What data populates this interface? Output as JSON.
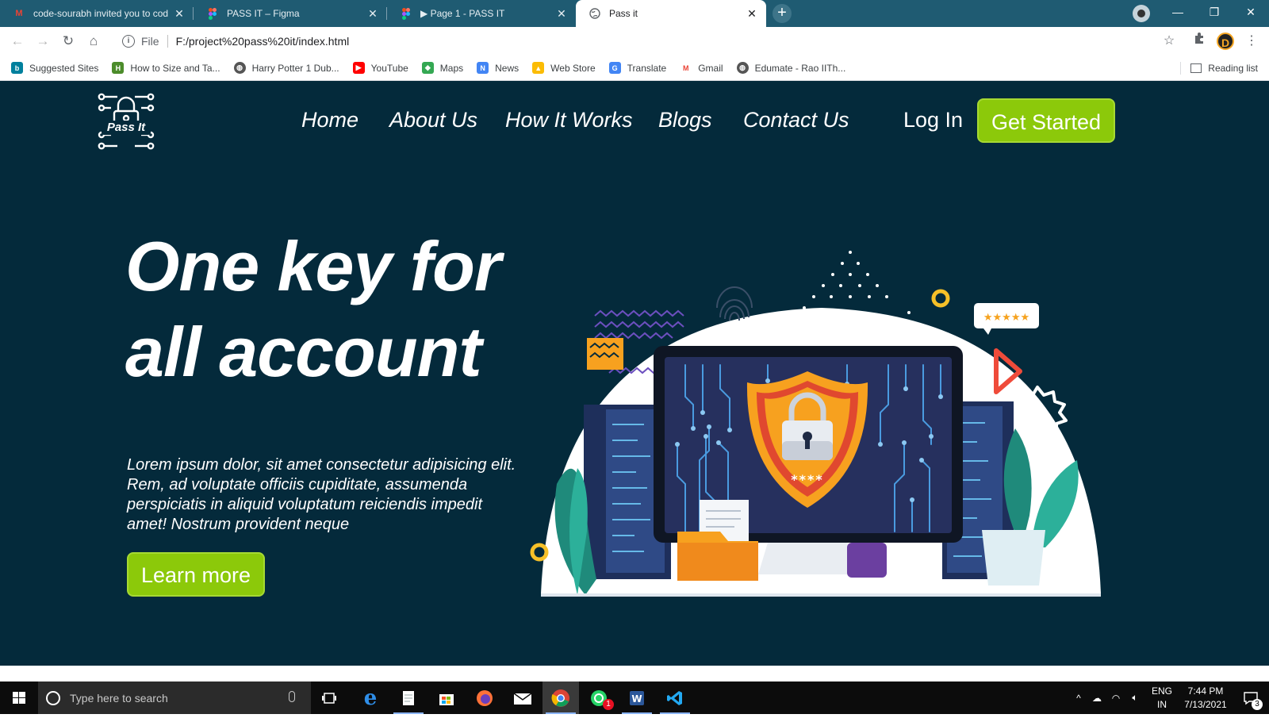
{
  "browser": {
    "tabs": [
      {
        "title": "code-sourabh invited you to cod",
        "icon": "gmail-icon"
      },
      {
        "title": "PASS IT – Figma",
        "icon": "figma-icon"
      },
      {
        "title": "▶ Page 1 - PASS IT",
        "icon": "figma-icon"
      },
      {
        "title": "Pass it",
        "icon": "globe-icon",
        "active": true
      }
    ],
    "address": {
      "scheme": "File",
      "url": "F:/project%20pass%20it/index.html"
    },
    "profile_initial": "D",
    "bookmarks": [
      {
        "label": "Suggested Sites",
        "icon": "bing-icon"
      },
      {
        "label": "How to Size and Ta...",
        "icon": "bookmark-icon"
      },
      {
        "label": "Harry Potter 1 Dub...",
        "icon": "globe-icon"
      },
      {
        "label": "YouTube",
        "icon": "youtube-icon"
      },
      {
        "label": "Maps",
        "icon": "maps-icon"
      },
      {
        "label": "News",
        "icon": "news-icon"
      },
      {
        "label": "Web Store",
        "icon": "webstore-icon"
      },
      {
        "label": "Translate",
        "icon": "translate-icon"
      },
      {
        "label": "Gmail",
        "icon": "gmail-icon"
      },
      {
        "label": "Edumate - Rao IITh...",
        "icon": "globe-icon"
      }
    ],
    "reading_list": "Reading list"
  },
  "site": {
    "logo_text": "Pass It",
    "nav": [
      "Home",
      "About Us",
      "How It Works",
      "Blogs",
      "Contact Us"
    ],
    "login": "Log In",
    "cta": "Get Started",
    "headline_line1": "One key for",
    "headline_line2": "all account",
    "body": "Lorem ipsum dolor, sit amet consectetur adipisicing elit. Rem, ad voluptate officiis cupiditate, assumenda perspiciatis in aliquid voluptatum reiciendis impedit amet! Nostrum provident neque",
    "learn_more": "Learn more",
    "illustration_password": "****",
    "colors": {
      "background": "#042a3b",
      "accent": "#8cc90a",
      "text": "#ffffff"
    }
  },
  "taskbar": {
    "search_placeholder": "Type here to search",
    "lang": "ENG",
    "region": "IN",
    "time": "7:44 PM",
    "date": "7/13/2021",
    "notification_count": "3",
    "whatsapp_badge": "1",
    "apps": [
      "task-view-icon",
      "edge-icon",
      "notepad-icon",
      "store-icon",
      "firefox-icon",
      "mail-icon",
      "chrome-icon",
      "whatsapp-icon",
      "word-icon",
      "vscode-icon"
    ]
  }
}
